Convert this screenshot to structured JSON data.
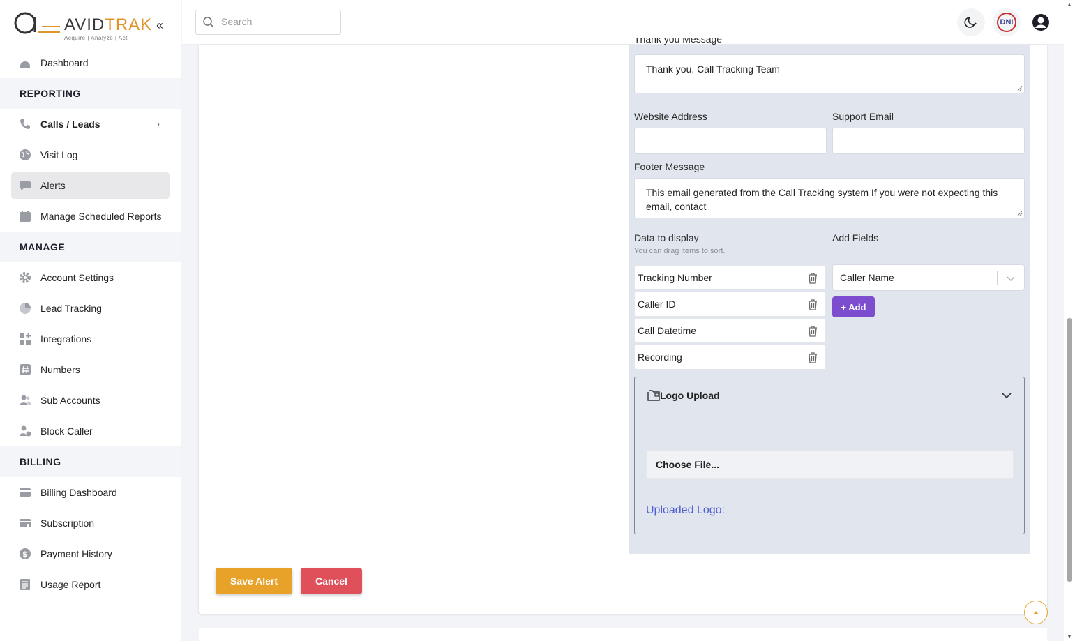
{
  "brand": {
    "name_part1": "AVID",
    "name_part2": "TRAK",
    "tagline": "Acquire | Analyze | Act",
    "accent_color": "#e0952a"
  },
  "sidebar": {
    "collapse_label": "«",
    "top_items": [
      {
        "label": "Dashboard",
        "icon": "dashboard-icon"
      }
    ],
    "sections": [
      {
        "title": "REPORTING",
        "items": [
          {
            "label": "Calls / Leads",
            "icon": "phone-icon",
            "has_submenu": true
          },
          {
            "label": "Visit Log",
            "icon": "globe-icon"
          },
          {
            "label": "Alerts",
            "icon": "chat-bubble-icon",
            "active": true
          },
          {
            "label": "Manage Scheduled Reports",
            "icon": "calendar-icon"
          }
        ]
      },
      {
        "title": "MANAGE",
        "items": [
          {
            "label": "Account Settings",
            "icon": "gear-icon"
          },
          {
            "label": "Lead Tracking",
            "icon": "pie-chart-icon"
          },
          {
            "label": "Integrations",
            "icon": "grid-plus-icon"
          },
          {
            "label": "Numbers",
            "icon": "hash-icon"
          },
          {
            "label": "Sub Accounts",
            "icon": "users-icon"
          },
          {
            "label": "Block Caller",
            "icon": "user-block-icon"
          }
        ]
      },
      {
        "title": "BILLING",
        "items": [
          {
            "label": "Billing Dashboard",
            "icon": "credit-card-icon"
          },
          {
            "label": "Subscription",
            "icon": "card-gear-icon"
          },
          {
            "label": "Payment History",
            "icon": "dollar-circle-icon"
          },
          {
            "label": "Usage Report",
            "icon": "report-icon"
          }
        ]
      }
    ]
  },
  "topbar": {
    "search_placeholder": "Search",
    "dni_label": "DNI"
  },
  "form": {
    "thank_you_label": "Thank you Message",
    "thank_you_value": "Thank you, Call Tracking Team",
    "website_label": "Website Address",
    "website_value": "",
    "support_email_label": "Support Email",
    "support_email_value": "",
    "footer_label": "Footer Message",
    "footer_value": "This email generated from the Call Tracking system If you were not expecting this email, contact",
    "data_display_label": "Data to display",
    "data_display_hint": "You can drag items to sort.",
    "add_fields_label": "Add Fields",
    "display_items": [
      "Tracking Number",
      "Caller ID",
      "Call Datetime",
      "Recording"
    ],
    "add_field_selected": "Caller Name",
    "add_button_label": "+ Add",
    "logo_upload_title": "Logo Upload",
    "choose_file_label": "Choose File...",
    "uploaded_logo_label": "Uploaded Logo:"
  },
  "actions": {
    "save_label": "Save Alert",
    "cancel_label": "Cancel"
  },
  "colors": {
    "save": "#e8a22a",
    "cancel": "#e0505a",
    "add": "#7c4dce",
    "uploaded_link": "#4f5ed0"
  }
}
